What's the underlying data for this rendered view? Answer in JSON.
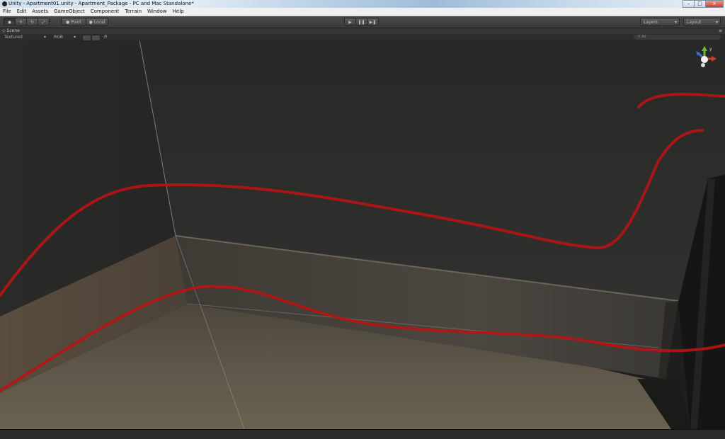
{
  "window": {
    "title": "Unity - Apartment01.unity - Apartment_Package - PC and Mac Standalone*",
    "minimize_glyph": "–",
    "maximize_glyph": "□",
    "close_glyph": "×"
  },
  "menu": {
    "items": [
      "File",
      "Edit",
      "Assets",
      "GameObject",
      "Component",
      "Terrain",
      "Window",
      "Help"
    ]
  },
  "toolbar": {
    "tools": [
      {
        "name": "view-tool",
        "icon": "eye-icon",
        "glyph": "◉",
        "selected": true
      },
      {
        "name": "move-tool",
        "icon": "move-arrows-icon",
        "glyph": "✛",
        "selected": false
      },
      {
        "name": "rotate-tool",
        "icon": "rotate-icon",
        "glyph": "↻",
        "selected": false
      },
      {
        "name": "scale-tool",
        "icon": "scale-icon",
        "glyph": "⤢",
        "selected": false
      }
    ],
    "pivot_label": "Pivot",
    "local_label": "Local",
    "play_glyph": "▶",
    "pause_glyph": "❚❚",
    "step_glyph": "▶❚",
    "layers_label": "Layers",
    "layout_label": "Layout"
  },
  "scene_panel": {
    "tab_label": "Scene",
    "tab_icon": "scene-icon",
    "render_mode": "Textured",
    "color_mode": "RGB",
    "search_placeholder": "All",
    "menu_glyph": "≡"
  },
  "gizmo": {
    "y_label": "y",
    "colors": {
      "x": "#d23a2a",
      "y": "#6ab83a",
      "z": "#3b6fd6"
    }
  },
  "colors": {
    "wall": "#2b2b29",
    "stroke": "#b81414",
    "floor": "#5e5548"
  }
}
